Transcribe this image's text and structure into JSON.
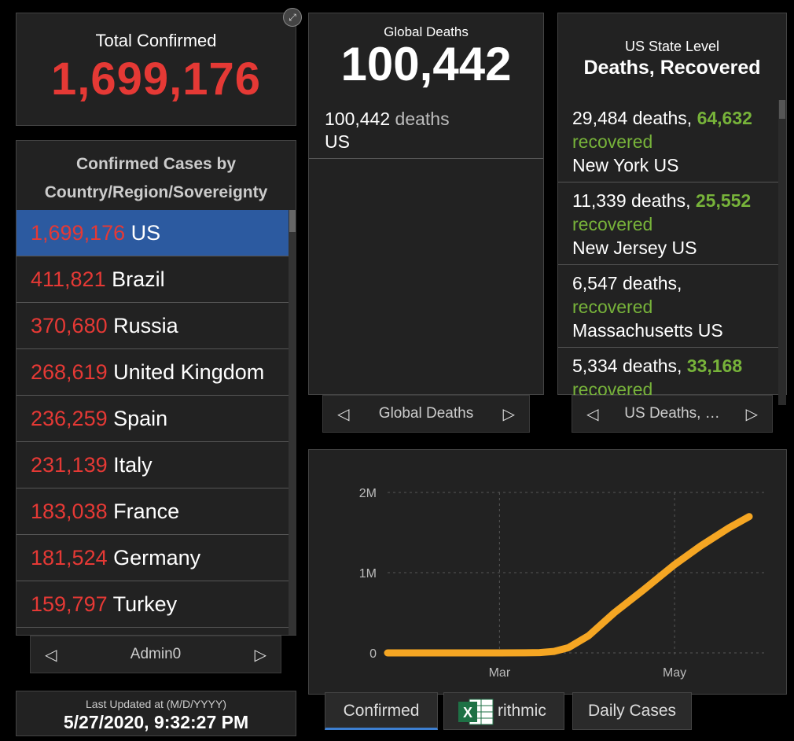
{
  "total": {
    "label": "Total Confirmed",
    "value": "1,699,176"
  },
  "country_list": {
    "title_line1": "Confirmed Cases by",
    "title_line2": "Country/Region/Sovereignty",
    "items": [
      {
        "count": "1,699,176",
        "name": "US",
        "selected": true
      },
      {
        "count": "411,821",
        "name": "Brazil"
      },
      {
        "count": "370,680",
        "name": "Russia"
      },
      {
        "count": "268,619",
        "name": "United Kingdom"
      },
      {
        "count": "236,259",
        "name": "Spain"
      },
      {
        "count": "231,139",
        "name": "Italy"
      },
      {
        "count": "183,038",
        "name": "France"
      },
      {
        "count": "181,524",
        "name": "Germany"
      },
      {
        "count": "159,797",
        "name": "Turkey"
      }
    ],
    "pager_label": "Admin0"
  },
  "updated": {
    "label": "Last Updated at (M/D/YYYY)",
    "value": "5/27/2020, 9:32:27 PM"
  },
  "global_deaths": {
    "label": "Global Deaths",
    "value": "100,442",
    "item_count": "100,442",
    "item_unit": "deaths",
    "item_name": "US",
    "pager_label": "Global Deaths"
  },
  "us_state": {
    "label": "US State Level",
    "heading": "Deaths, Recovered",
    "rows": [
      {
        "deaths": "29,484 deaths,",
        "recovered_num": "64,632",
        "recovered_word": "recovered",
        "state": "New York US"
      },
      {
        "deaths": "11,339 deaths,",
        "recovered_num": "25,552",
        "recovered_word": "recovered",
        "state": "New Jersey US"
      },
      {
        "deaths": "6,547 deaths,",
        "recovered_num": "",
        "recovered_word": "recovered",
        "state": "Massachusetts US"
      },
      {
        "deaths": "5,334 deaths,",
        "recovered_num": "33,168",
        "recovered_word": "recovered",
        "state": ""
      }
    ],
    "pager_label": "US Deaths, …"
  },
  "tabs": [
    {
      "label": "Confirmed",
      "active": true
    },
    {
      "label": "rithmic",
      "active": false
    },
    {
      "label": "Daily Cases",
      "active": false
    }
  ],
  "colors": {
    "accent_red": "#e53935",
    "recovered_green": "#77b33a",
    "line_orange": "#f5a623",
    "selected_blue": "#2c5aa0"
  },
  "icons": {
    "expand": "expand-icon",
    "prev": "chevron-left-icon",
    "next": "chevron-right-icon",
    "excel": "excel-icon"
  },
  "chart_data": {
    "type": "line",
    "xlabel": "",
    "ylabel": "",
    "x_ticks": [
      "Mar",
      "May"
    ],
    "y_ticks": [
      "0",
      "1M",
      "2M"
    ],
    "ylim": [
      0,
      2000000
    ],
    "grid": true,
    "series": [
      {
        "x": [
          "2020-01-22",
          "2020-02-01",
          "2020-02-15",
          "2020-03-01",
          "2020-03-10",
          "2020-03-15",
          "2020-03-20",
          "2020-03-25",
          "2020-04-01",
          "2020-04-10",
          "2020-04-20",
          "2020-05-01",
          "2020-05-10",
          "2020-05-20",
          "2020-05-27"
        ],
        "values": [
          0,
          10,
          15,
          80,
          1000,
          3500,
          19000,
          65000,
          213000,
          500000,
          780000,
          1100000,
          1330000,
          1560000,
          1699176
        ]
      }
    ]
  }
}
